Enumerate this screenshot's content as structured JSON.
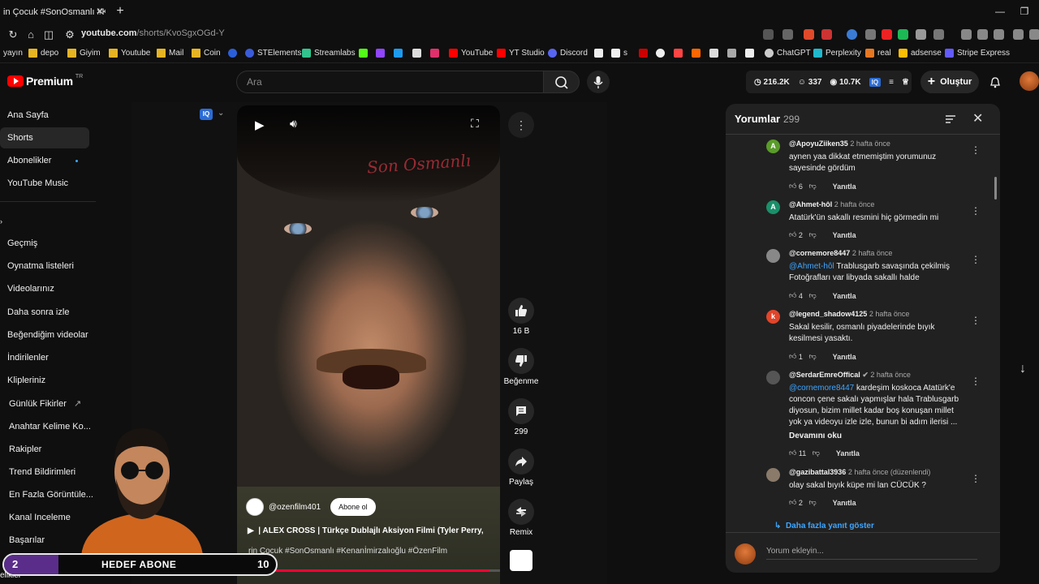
{
  "browser": {
    "tab_title": "in Çocuk #SonOsmanlı #Ken",
    "url_host": "youtube.com",
    "url_path": "/shorts/KvoSgxOGd-Y",
    "bookmarks": [
      "yayın",
      "depo",
      "Giyim",
      "Youtube",
      "Mail",
      "Coin",
      "STElements",
      "Streamlabs",
      "YouTube",
      "YT Studio",
      "Discord",
      "s",
      "ChatGPT",
      "Perplexity",
      "real",
      "adsense",
      "Stripe Express"
    ]
  },
  "header": {
    "logo": "Premium",
    "logo_region": "TR",
    "search_placeholder": "Ara",
    "stat_views": "216.2K",
    "stat_subs": "337",
    "stat_watch": "10.7K",
    "create_label": "Oluştur"
  },
  "sidebar": {
    "items": [
      "Ana Sayfa",
      "Shorts",
      "Abonelikler",
      "YouTube Music",
      "Geçmiş",
      "Oynatma listeleri",
      "Videolarınız",
      "Daha sonra izle",
      "Beğendiğim videolar",
      "İndirilenler",
      "Klipleriniz",
      "Günlük Fikirler",
      "Anahtar Kelime Ko...",
      "Rakipler",
      "Trend Bildirimleri",
      "En Fazla Görüntüle...",
      "Kanal Inceleme",
      "Başarılar",
      "elikler"
    ]
  },
  "video": {
    "watermark": "Son Osmanlı",
    "channel": "@ozenfilm401",
    "subscribe": "Abone ol",
    "title": "| ALEX CROSS | Türkçe Dublajlı Aksiyon Filmi (Tyler Perry,",
    "tags": "rin Çocuk #SonOsmanlı #Kenanİmirzalıoğlu #ÖzenFilm",
    "progress": 0.96
  },
  "actions": {
    "likes": "16 B",
    "dislike": "Beğenme",
    "comments": "299",
    "share": "Paylaş",
    "remix": "Remix"
  },
  "comments_panel": {
    "title": "Yorumlar",
    "count": "299",
    "reply_label": "Yanıtla",
    "more_replies": "Daha fazla yanıt göster",
    "input_placeholder": "Yorum ekleyin...",
    "comments": [
      {
        "user": "@ApoyuZiiken35",
        "ago": "2 hafta önce",
        "text": "aynen yaa dikkat etmemiştim yorumunuz sayesinde gördüm",
        "likes": "6",
        "avatar_letter": "A",
        "avatar_color": "#5a9b2a"
      },
      {
        "user": "@Ahmet-hôl",
        "ago": "2 hafta önce",
        "text": "Atatürk'ün sakallı resmini hiç görmedin mi",
        "likes": "2",
        "avatar_letter": "A",
        "avatar_color": "#1a8f6a"
      },
      {
        "user": "@cornemore8447",
        "ago": "2 hafta önce",
        "mention": "@Ahmet-hôl",
        "text": " Trablusgarb savaşında çekilmiş Fotoğrafları var libyada sakallı halde",
        "likes": "4",
        "avatar_letter": "",
        "avatar_color": "#888888"
      },
      {
        "user": "@legend_shadow4125",
        "ago": "2 hafta önce",
        "text": "Sakal kesilir, osmanlı piyadelerinde bıyık kesilmesi yasaktı.",
        "likes": "1",
        "avatar_letter": "k",
        "avatar_color": "#e0452a"
      },
      {
        "user": "@SerdarEmreOffical",
        "ago": "2 hafta önce",
        "mention": "@cornemore8447",
        "text": " kardeşim koskoca Atatürk'e concon çene sakalı yapmışlar hala Trablusgarb diyosun, bizim millet kadar boş konuşan millet yok ya videoyu izle izle, bunun bi adım ilerisi ...",
        "read_more": "Devamını oku",
        "likes": "11",
        "avatar_letter": "",
        "avatar_color": "#555555"
      },
      {
        "user": "@gazibattal3936",
        "ago": "2 hafta önce (düzenlendi)",
        "text": "olay sakal bıyık küpe mi lan  CÜCÜK ?",
        "likes": "2",
        "avatar_letter": "",
        "avatar_color": "#8a7a6a"
      }
    ]
  },
  "overlay": {
    "goal_current": "2",
    "goal_label": "HEDEF ABONE",
    "goal_target": "10",
    "goal_progress": 0.2
  }
}
